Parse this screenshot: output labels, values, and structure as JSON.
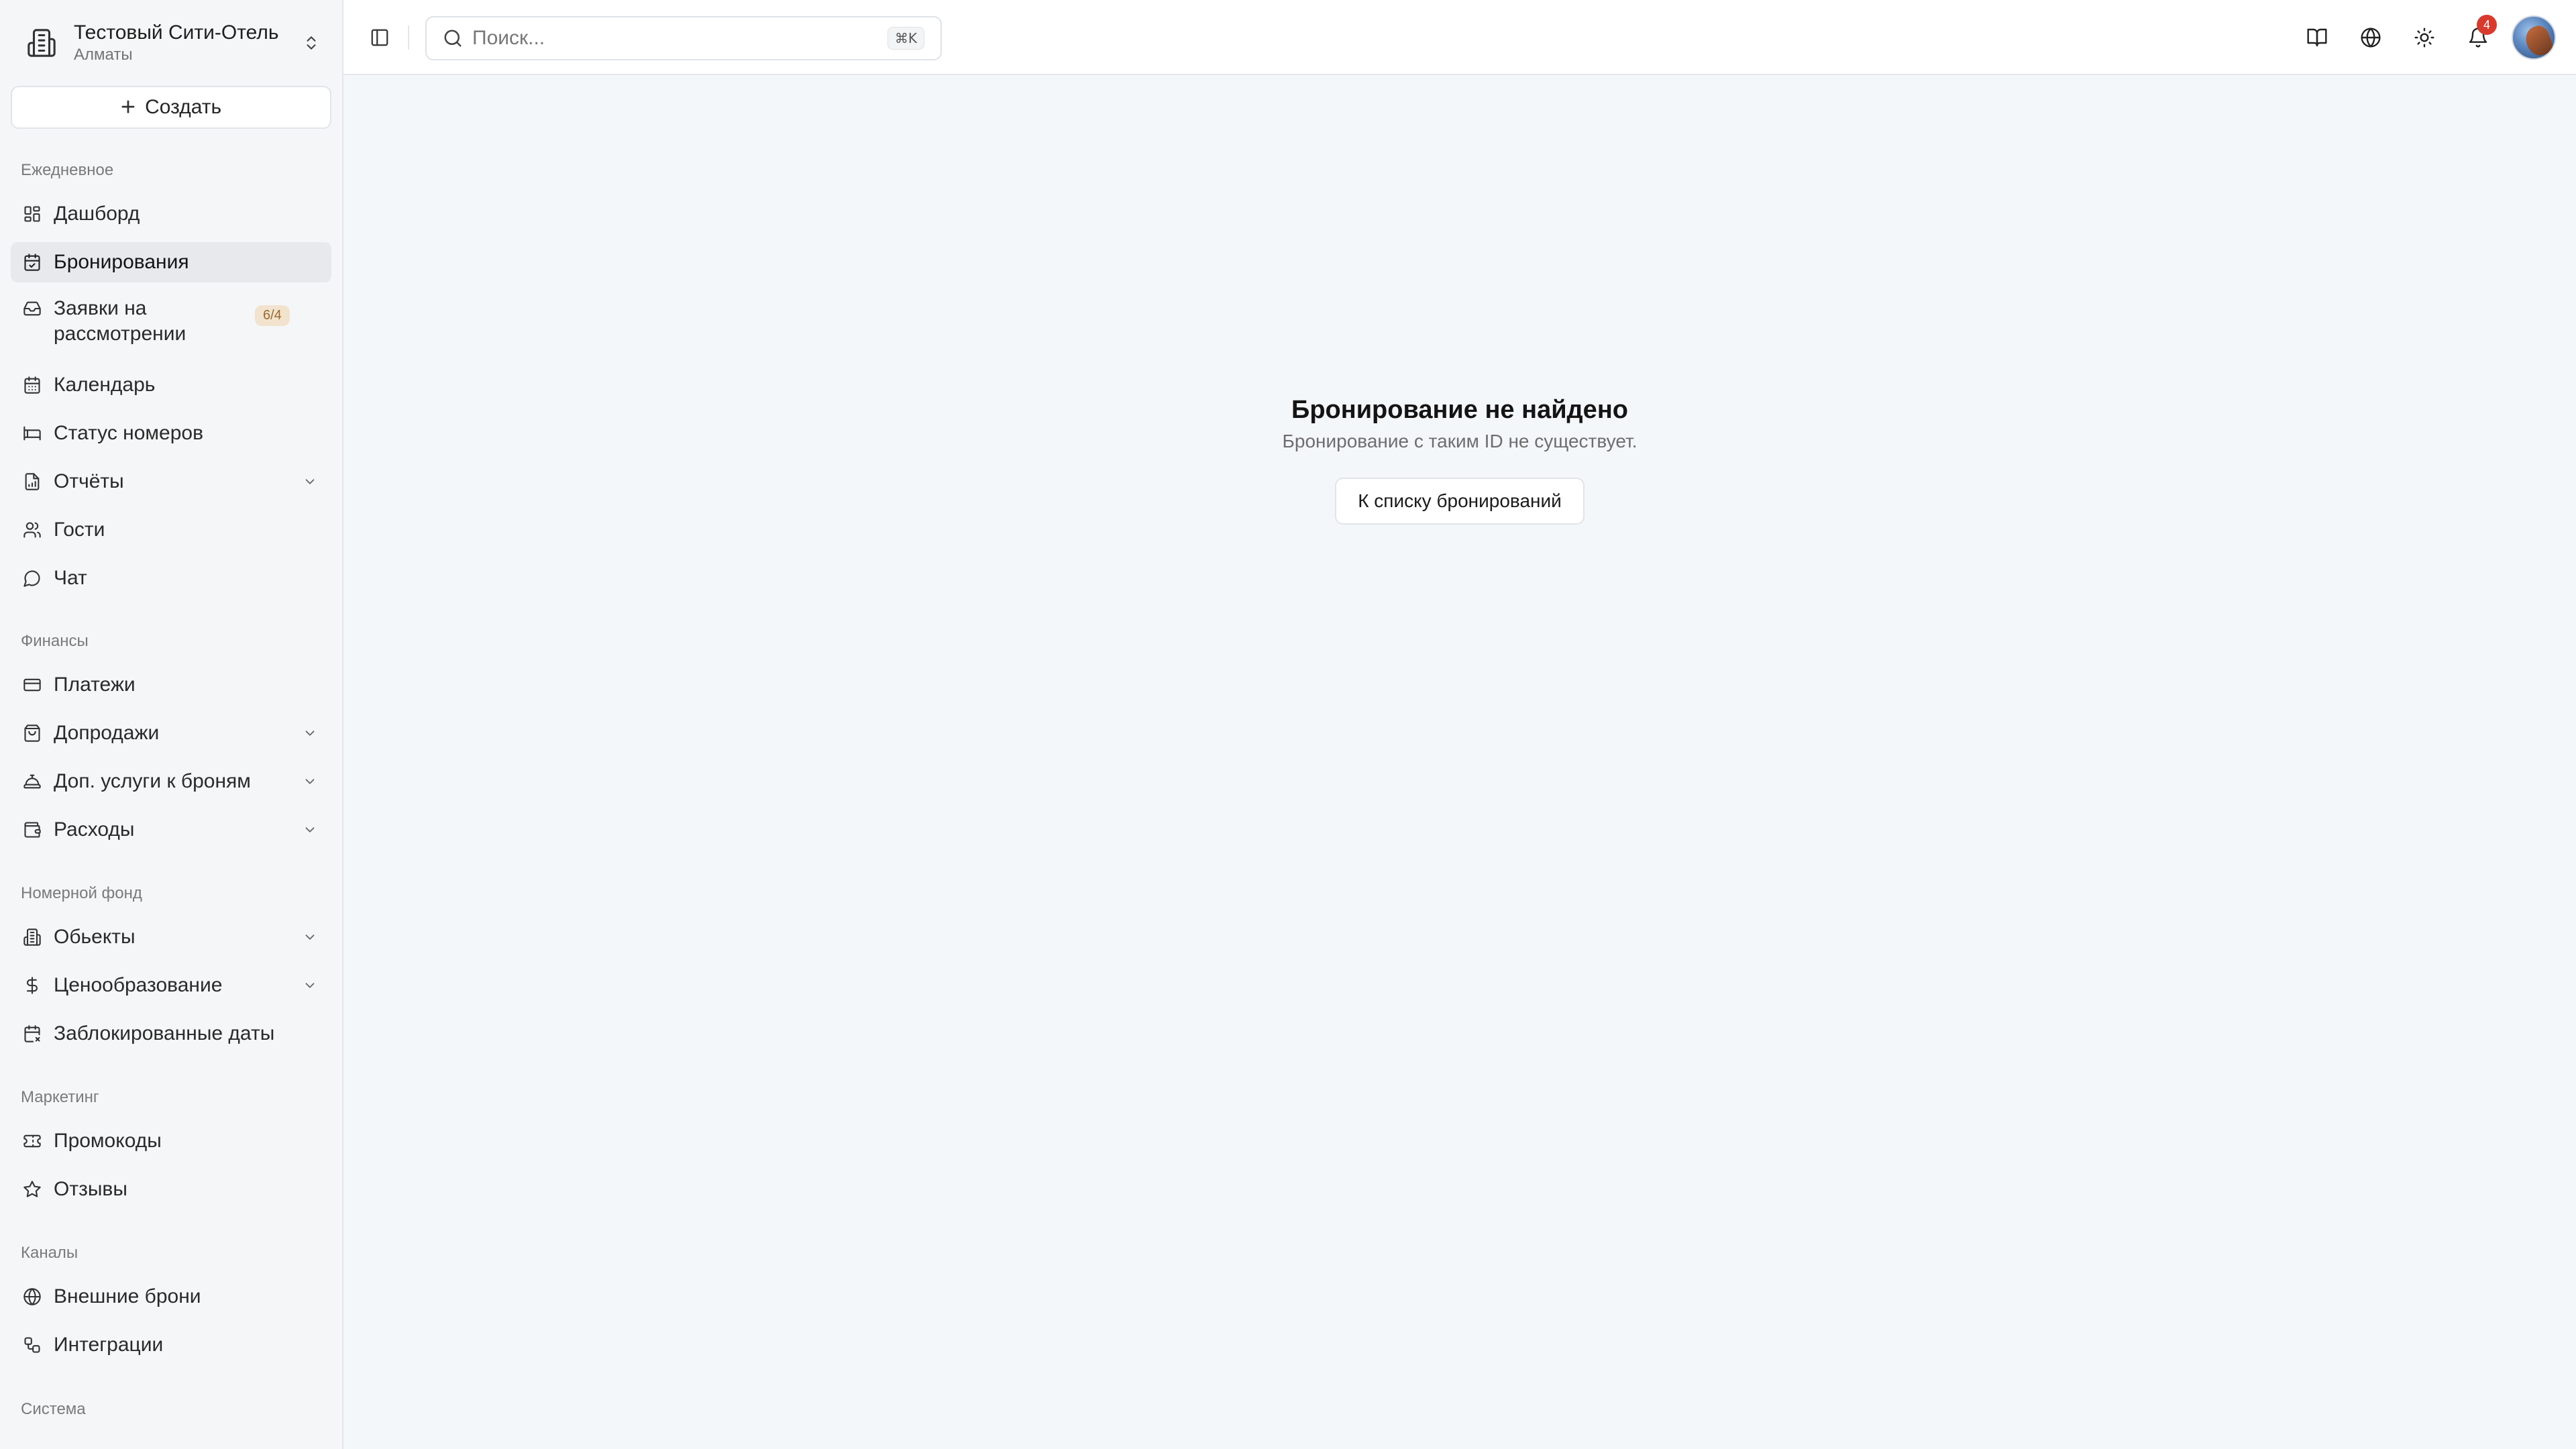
{
  "org": {
    "name": "Тестовый Сити-Отель",
    "city": "Алматы"
  },
  "create_label": "Создать",
  "sections": {
    "daily": "Ежедневное",
    "finance": "Финансы",
    "rooms": "Номерной фонд",
    "marketing": "Маркетинг",
    "channels": "Каналы",
    "system": "Система"
  },
  "nav": {
    "dashboard": "Дашборд",
    "bookings": "Бронирования",
    "requests": "Заявки на рассмотрении",
    "requests_badge": "6/4",
    "calendar": "Календарь",
    "room_status": "Статус номеров",
    "reports": "Отчёты",
    "guests": "Гости",
    "chat": "Чат",
    "payments": "Платежи",
    "upsells": "Допродажи",
    "extras": "Доп. услуги к броням",
    "expenses": "Расходы",
    "objects": "Обьекты",
    "pricing": "Ценообразование",
    "blocked_dates": "Заблокированные даты",
    "promocodes": "Промокоды",
    "reviews": "Отзывы",
    "external_bookings": "Внешние брони",
    "integrations": "Интеграции"
  },
  "search": {
    "placeholder": "Поиск...",
    "shortcut": "⌘K"
  },
  "notifications_count": "4",
  "empty": {
    "title": "Бронирование не найдено",
    "subtitle": "Бронирование с таким ID не существует.",
    "button": "К списку бронирований"
  }
}
